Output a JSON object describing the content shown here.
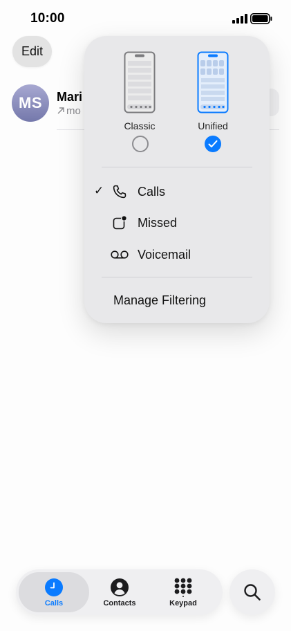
{
  "status_bar": {
    "time": "10:00"
  },
  "toolbar": {
    "edit_label": "Edit"
  },
  "call_list": {
    "rows": [
      {
        "initials": "MS",
        "name": "Mari",
        "subtitle": "mo"
      }
    ]
  },
  "filter_menu": {
    "layouts": [
      {
        "label": "Classic",
        "selected": false
      },
      {
        "label": "Unified",
        "selected": true
      }
    ],
    "filters": [
      {
        "label": "Calls",
        "checked": true,
        "icon": "phone-icon"
      },
      {
        "label": "Missed",
        "checked": false,
        "icon": "missed-badge-icon"
      },
      {
        "label": "Voicemail",
        "checked": false,
        "icon": "voicemail-icon"
      }
    ],
    "checkmark": "✓",
    "manage_label": "Manage Filtering"
  },
  "tab_bar": {
    "tabs": [
      {
        "label": "Calls",
        "icon": "calls-tab-icon",
        "active": true
      },
      {
        "label": "Contacts",
        "icon": "contacts-icon",
        "active": false
      },
      {
        "label": "Keypad",
        "icon": "keypad-icon",
        "active": false
      }
    ],
    "search_icon": "search-icon"
  },
  "colors": {
    "accent": "#0a7bff",
    "avatar_top": "#a7a8d1",
    "avatar_bottom": "#7478ab",
    "menu_bg": "#e8e8ea"
  }
}
